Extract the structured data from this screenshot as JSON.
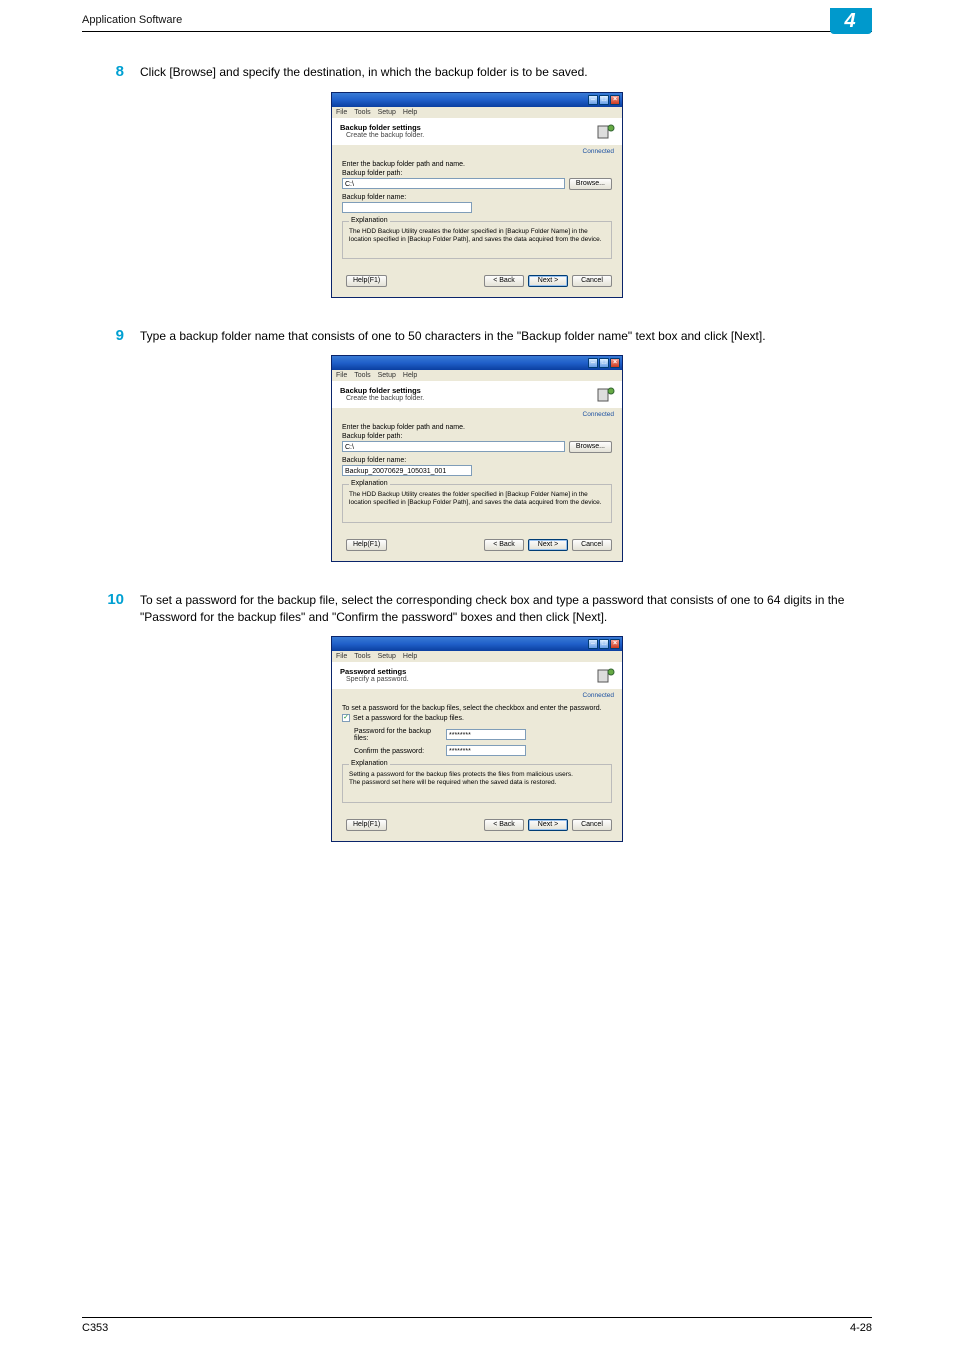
{
  "header": {
    "section": "Application Software",
    "chapter": "4"
  },
  "steps": {
    "s8": {
      "num": "8",
      "text": "Click [Browse] and specify the destination, in which the backup folder is to be saved."
    },
    "s9": {
      "num": "9",
      "text": "Type a backup folder name that consists of one to 50 characters in the \"Backup folder name\" text box and click [Next]."
    },
    "s10": {
      "num": "10",
      "text": "To set a password for the backup file, select the corresponding check box and type a password that consists of one to 64 digits in the \"Password for the backup files\" and \"Confirm the password\" boxes and then click [Next]."
    }
  },
  "menus": {
    "file": "File",
    "tools": "Tools",
    "setup": "Setup",
    "help": "Help"
  },
  "winbtn": {
    "min": "–",
    "max": "□",
    "close": "×"
  },
  "common": {
    "connected": "Connected",
    "help": "Help(F1)",
    "back": "< Back",
    "next": "Next >",
    "cancel": "Cancel",
    "browse": "Browse...",
    "explanation_legend": "Explanation"
  },
  "d1": {
    "title": "Backup folder settings",
    "subtitle": "Create the backup folder.",
    "enter": "Enter the backup folder path and name.",
    "path_label": "Backup folder path:",
    "path_value": "C:\\",
    "name_label": "Backup folder name:",
    "name_value": "",
    "exp": "The HDD Backup Utility creates the folder specified in [Backup Folder Name] in the location specified in [Backup Folder Path], and saves the data acquired from the device."
  },
  "d2": {
    "title": "Backup folder settings",
    "subtitle": "Create the backup folder.",
    "enter": "Enter the backup folder path and name.",
    "path_label": "Backup folder path:",
    "path_value": "C:\\",
    "name_label": "Backup folder name:",
    "name_value": "Backup_20070629_105031_001",
    "exp": "The HDD Backup Utility creates the folder specified in [Backup Folder Name] in the location specified in [Backup Folder Path], and saves the data acquired from the device."
  },
  "d3": {
    "title": "Password settings",
    "subtitle": "Specify a password.",
    "intro": "To set a password for the backup files, select the checkbox and enter the password.",
    "chk_label": "Set a password for the backup files.",
    "pw_label": "Password for the backup files:",
    "pw_value": "********",
    "cf_label": "Confirm the password:",
    "cf_value": "********",
    "exp": "Setting a password for the backup files protects the files from malicious users.\nThe password set here will be required when the saved data is restored."
  },
  "footer": {
    "left": "C353",
    "right": "4-28"
  }
}
